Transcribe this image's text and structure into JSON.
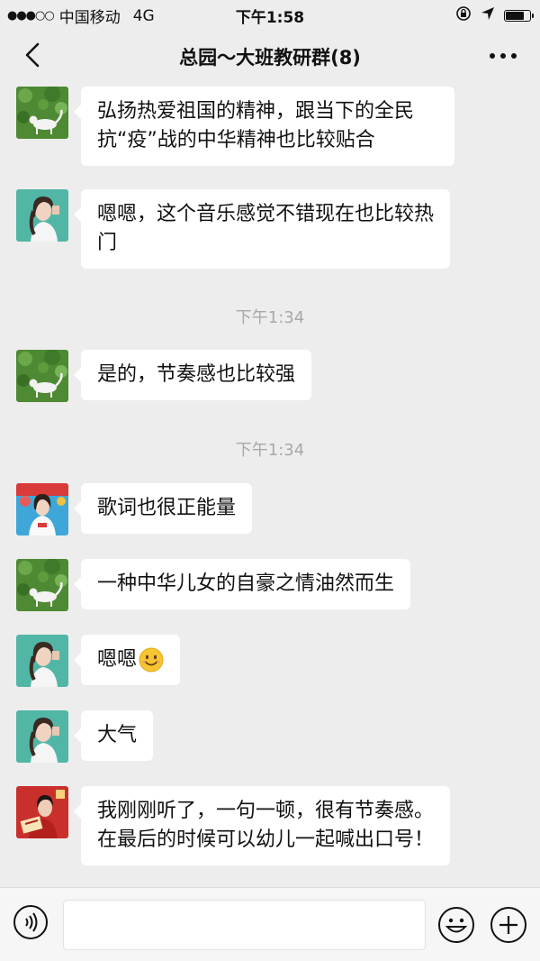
{
  "status_bar": {
    "signal_dots": "●●●○○",
    "carrier": "中国移动",
    "network": "4G",
    "time": "下午1:58",
    "battery_level": 0.85
  },
  "nav": {
    "title": "总园～大班教研群(8)"
  },
  "messages": [
    {
      "sender": "cat-avatar",
      "text": "弘扬热爱祖国的精神，跟当下的全民抗“疫”战的中华精神也比较贴合"
    },
    {
      "sender": "girl-avatar",
      "text": "嗯嗯，这个音乐感觉不错现在也比较热门"
    },
    {
      "type": "time",
      "text": "下午1:34"
    },
    {
      "sender": "cat-avatar",
      "text": "是的，节奏感也比较强"
    },
    {
      "type": "time",
      "text": "下午1:34"
    },
    {
      "sender": "girl-red-avatar",
      "text": "歌词也很正能量"
    },
    {
      "sender": "cat-avatar",
      "text": "一种中华儿女的自豪之情油然而生"
    },
    {
      "sender": "girl-avatar",
      "text": "嗯嗯",
      "emoji": "smile-emoji"
    },
    {
      "sender": "girl-avatar",
      "text": "大气"
    },
    {
      "sender": "man-avatar",
      "text": "我刚刚听了，一句一顿，很有节奏感。在最后的时候可以幼儿一起喊出口号！"
    }
  ],
  "input": {
    "value": "",
    "placeholder": ""
  },
  "colors": {
    "background": "#ededed",
    "bubble": "#ffffff",
    "time_label": "#a8a8a8",
    "cat_avatar_green": "#5a8f3c",
    "girl_avatar_teal": "#4fb3a3"
  }
}
